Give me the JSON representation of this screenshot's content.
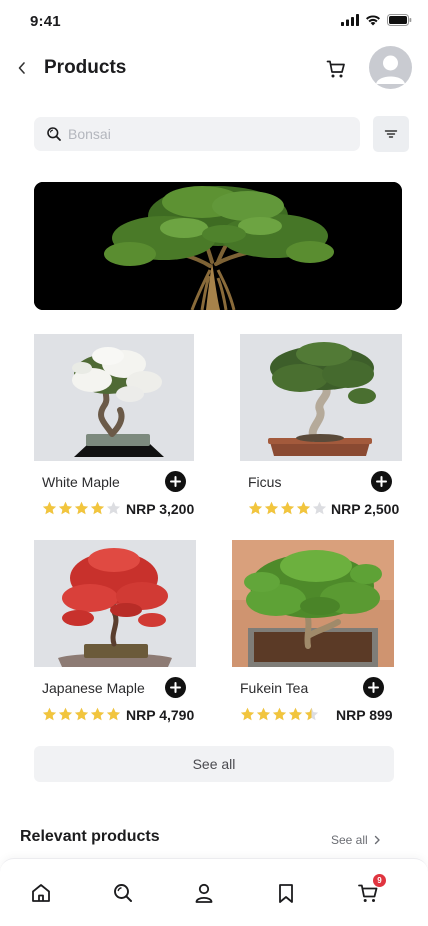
{
  "status": {
    "time": "9:41"
  },
  "header": {
    "title": "Products"
  },
  "search": {
    "placeholder": "Bonsai",
    "value": ""
  },
  "products": [
    {
      "name": "White Maple",
      "rating": 4,
      "price": "NRP 3,200"
    },
    {
      "name": "Ficus",
      "rating": 4,
      "price": "NRP 2,500"
    },
    {
      "name": "Japanese Maple",
      "rating": 5,
      "price": "NRP 4,790"
    },
    {
      "name": "Fukein Tea",
      "rating": 4.5,
      "price": "NRP 899"
    }
  ],
  "see_all_button": "See all",
  "relevant": {
    "title": "Relevant products",
    "link": "See all"
  },
  "nav": {
    "cart_badge": "9"
  },
  "colors": {
    "star": "#f2c53d",
    "star_empty": "#dcdde1",
    "badge": "#e0343f",
    "accent": "#111111"
  },
  "icons": [
    "back-icon",
    "cart-icon",
    "avatar-icon",
    "search-icon",
    "filter-icon",
    "plus-icon",
    "star-icon",
    "home-icon",
    "search-nav-icon",
    "user-icon",
    "bookmark-icon",
    "cart-nav-icon",
    "chevron-right-icon"
  ]
}
